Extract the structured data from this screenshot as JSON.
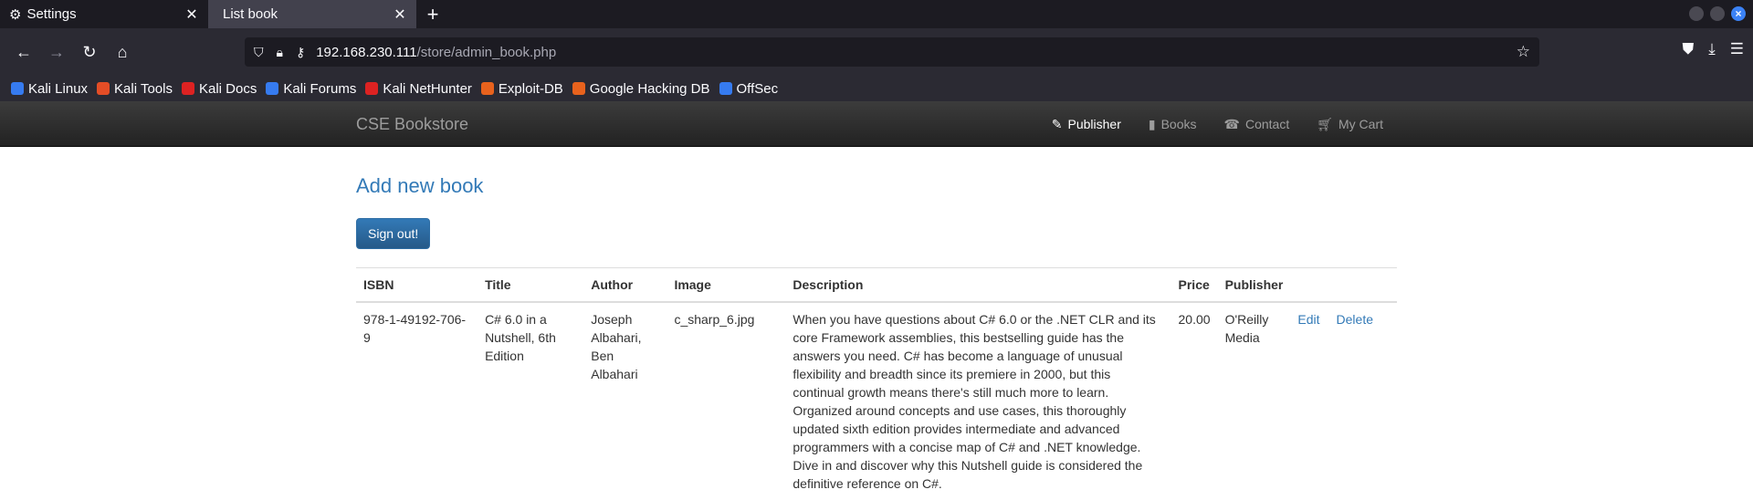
{
  "browser": {
    "tabs": [
      {
        "label": "Settings",
        "icon": "gear-icon"
      },
      {
        "label": "List book",
        "icon": ""
      }
    ],
    "new_tab_label": "+",
    "url": {
      "host": "192.168.230.111",
      "path": "/store/admin_book.php"
    },
    "bookmarks": [
      {
        "label": "Kali Linux",
        "color": "#367bf0"
      },
      {
        "label": "Kali Tools",
        "color": "#e44d26"
      },
      {
        "label": "Kali Docs",
        "color": "#d22"
      },
      {
        "label": "Kali Forums",
        "color": "#367bf0"
      },
      {
        "label": "Kali NetHunter",
        "color": "#d22"
      },
      {
        "label": "Exploit-DB",
        "color": "#e8621d"
      },
      {
        "label": "Google Hacking DB",
        "color": "#e8621d"
      },
      {
        "label": "OffSec",
        "color": "#367bf0"
      }
    ]
  },
  "site": {
    "brand": "CSE Bookstore",
    "nav": [
      {
        "label": "Publisher",
        "icon": "pencil-icon",
        "active": true
      },
      {
        "label": "Books",
        "icon": "book-icon"
      },
      {
        "label": "Contact",
        "icon": "phone-icon"
      },
      {
        "label": "My Cart",
        "icon": "cart-icon"
      }
    ]
  },
  "page": {
    "add_link": "Add new book",
    "signout_label": "Sign out!",
    "columns": [
      "ISBN",
      "Title",
      "Author",
      "Image",
      "Description",
      "Price",
      "Publisher",
      ""
    ],
    "rows": [
      {
        "isbn": "978-1-49192-706-9",
        "title": "C# 6.0 in a Nutshell, 6th Edition",
        "author": "Joseph Albahari, Ben Albahari",
        "image": "c_sharp_6.jpg",
        "description": "When you have questions about C# 6.0 or the .NET CLR and its core Framework assemblies, this bestselling guide has the answers you need. C# has become a language of unusual flexibility and breadth since its premiere in 2000, but this continual growth means there's still much more to learn. Organized around concepts and use cases, this thoroughly updated sixth edition provides intermediate and advanced programmers with a concise map of C# and .NET knowledge. Dive in and discover why this Nutshell guide is considered the definitive reference on C#.",
        "price": "20.00",
        "publisher": "O'Reilly Media",
        "edit": "Edit",
        "delete": "Delete"
      }
    ]
  }
}
